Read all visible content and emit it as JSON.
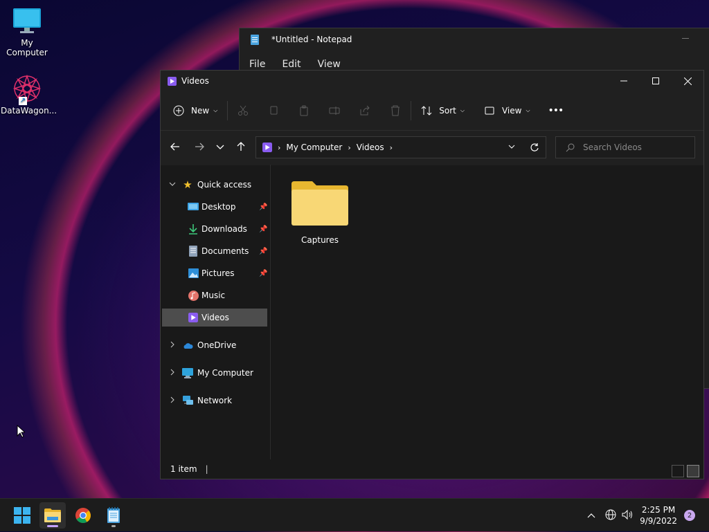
{
  "desktop": {
    "icons": [
      {
        "label": "My Computer",
        "icon": "monitor-icon"
      },
      {
        "label": "DataWagon...",
        "icon": "shortcut-app-icon"
      }
    ]
  },
  "notepad": {
    "title": "*Untitled - Notepad",
    "menu": [
      "File",
      "Edit",
      "View"
    ]
  },
  "explorer": {
    "title": "Videos",
    "toolbar": {
      "new_label": "New",
      "sort_label": "Sort",
      "view_label": "View",
      "more_label": "•••"
    },
    "address": {
      "crumbs": [
        "My Computer",
        "Videos"
      ]
    },
    "search": {
      "placeholder": "Search Videos"
    },
    "nav": {
      "quick_access": "Quick access",
      "items": [
        {
          "label": "Desktop",
          "icon": "desktop-icon",
          "pinned": true
        },
        {
          "label": "Downloads",
          "icon": "download-icon",
          "pinned": true
        },
        {
          "label": "Documents",
          "icon": "documents-icon",
          "pinned": true
        },
        {
          "label": "Pictures",
          "icon": "pictures-icon",
          "pinned": true
        },
        {
          "label": "Music",
          "icon": "music-icon",
          "pinned": false
        },
        {
          "label": "Videos",
          "icon": "videos-icon",
          "pinned": false,
          "selected": true
        }
      ],
      "onedrive": "OneDrive",
      "my_computer": "My Computer",
      "network": "Network"
    },
    "content": {
      "items": [
        {
          "label": "Captures",
          "icon": "folder-icon"
        }
      ]
    },
    "status": {
      "count": "1 item"
    }
  },
  "taskbar": {
    "apps": [
      "windows-start-icon",
      "file-explorer-icon",
      "chrome-icon",
      "notepad-icon"
    ],
    "clock": {
      "time": "2:25 PM",
      "date": "9/9/2022"
    },
    "notifications": "2"
  },
  "colors": {
    "accent": "#c5a3ff",
    "folder": "#f8d775",
    "selection": "#4d4d4d"
  }
}
